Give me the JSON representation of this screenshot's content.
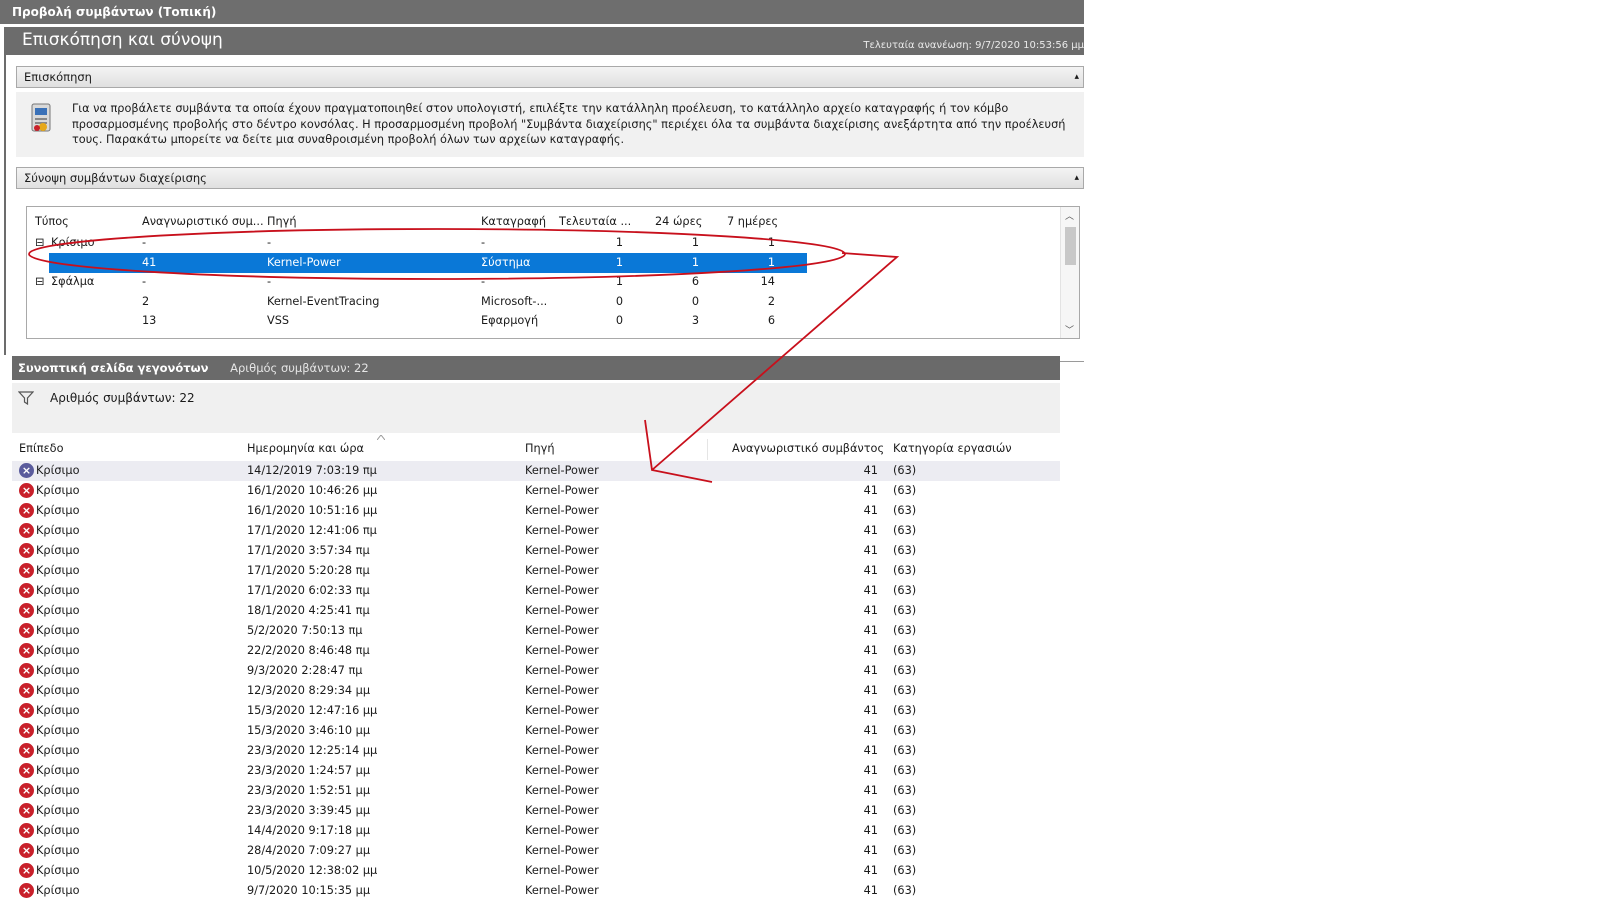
{
  "window": {
    "title": "Προβολή συμβάντων (Τοπική)"
  },
  "header": {
    "title": "Επισκόπηση και σύνοψη",
    "last_refresh": "Τελευταία ανανέωση: 9/7/2020 10:53:56 μμ"
  },
  "overview": {
    "label": "Επισκόπηση",
    "text": "Για να προβάλετε συμβάντα τα οποία έχουν πραγματοποιηθεί στον υπολογιστή, επιλέξτε την κατάλληλη προέλευση, το κατάλληλο αρχείο καταγραφής ή τον κόμβο προσαρμοσμένης προβολής στο δέντρο κονσόλας. Η προσαρμοσμένη προβολή \"Συμβάντα διαχείρισης\" περιέχει όλα τα συμβάντα διαχείρισης ανεξάρτητα από την προέλευσή τους. Παρακάτω μπορείτε να δείτε μια συναθροισμένη προβολή όλων των αρχείων καταγραφής."
  },
  "summary": {
    "label": "Σύνοψη συμβάντων διαχείρισης",
    "columns": [
      "Τύπος",
      "Αναγνωριστικό συμ...",
      "Πηγή",
      "Καταγραφή",
      "Τελευταία ...",
      "24 ώρες",
      "7 ημέρες"
    ],
    "rows": [
      {
        "type": "Κρίσιμο",
        "expand": "⊟",
        "id": "-",
        "source": "-",
        "log": "-",
        "last": "1",
        "h24": "1",
        "d7": "1"
      },
      {
        "type": "",
        "expand": "",
        "id": "41",
        "source": "Kernel-Power",
        "log": "Σύστημα",
        "last": "1",
        "h24": "1",
        "d7": "1"
      },
      {
        "type": "Σφάλμα",
        "expand": "⊟",
        "id": "-",
        "source": "-",
        "log": "-",
        "last": "1",
        "h24": "6",
        "d7": "14"
      },
      {
        "type": "",
        "expand": "",
        "id": "2",
        "source": "Kernel-EventTracing",
        "log": "Microsoft-...",
        "last": "0",
        "h24": "0",
        "d7": "2"
      },
      {
        "type": "",
        "expand": "",
        "id": "13",
        "source": "VSS",
        "log": "Εφαρμογή",
        "last": "0",
        "h24": "3",
        "d7": "6"
      }
    ]
  },
  "events_page": {
    "title": "Συνοπτική σελίδα γεγονότων",
    "count_label": "Αριθμός συμβάντων: 22",
    "filter_count": "Αριθμός συμβάντων: 22",
    "columns": [
      "Επίπεδο",
      "Ημερομηνία και ώρα",
      "Πηγή",
      "Αναγνωριστικό συμβάντος",
      "Κατηγορία εργασιών"
    ],
    "rows": [
      {
        "level": "Κρίσιμο",
        "datetime": "14/12/2019 7:03:19 πμ",
        "source": "Kernel-Power",
        "id": "41",
        "category": "(63)"
      },
      {
        "level": "Κρίσιμο",
        "datetime": "16/1/2020 10:46:26 μμ",
        "source": "Kernel-Power",
        "id": "41",
        "category": "(63)"
      },
      {
        "level": "Κρίσιμο",
        "datetime": "16/1/2020 10:51:16 μμ",
        "source": "Kernel-Power",
        "id": "41",
        "category": "(63)"
      },
      {
        "level": "Κρίσιμο",
        "datetime": "17/1/2020 12:41:06 πμ",
        "source": "Kernel-Power",
        "id": "41",
        "category": "(63)"
      },
      {
        "level": "Κρίσιμο",
        "datetime": "17/1/2020 3:57:34 πμ",
        "source": "Kernel-Power",
        "id": "41",
        "category": "(63)"
      },
      {
        "level": "Κρίσιμο",
        "datetime": "17/1/2020 5:20:28 πμ",
        "source": "Kernel-Power",
        "id": "41",
        "category": "(63)"
      },
      {
        "level": "Κρίσιμο",
        "datetime": "17/1/2020 6:02:33 πμ",
        "source": "Kernel-Power",
        "id": "41",
        "category": "(63)"
      },
      {
        "level": "Κρίσιμο",
        "datetime": "18/1/2020 4:25:41 πμ",
        "source": "Kernel-Power",
        "id": "41",
        "category": "(63)"
      },
      {
        "level": "Κρίσιμο",
        "datetime": "5/2/2020 7:50:13 πμ",
        "source": "Kernel-Power",
        "id": "41",
        "category": "(63)"
      },
      {
        "level": "Κρίσιμο",
        "datetime": "22/2/2020 8:46:48 πμ",
        "source": "Kernel-Power",
        "id": "41",
        "category": "(63)"
      },
      {
        "level": "Κρίσιμο",
        "datetime": "9/3/2020 2:28:47 πμ",
        "source": "Kernel-Power",
        "id": "41",
        "category": "(63)"
      },
      {
        "level": "Κρίσιμο",
        "datetime": "12/3/2020 8:29:34 μμ",
        "source": "Kernel-Power",
        "id": "41",
        "category": "(63)"
      },
      {
        "level": "Κρίσιμο",
        "datetime": "15/3/2020 12:47:16 μμ",
        "source": "Kernel-Power",
        "id": "41",
        "category": "(63)"
      },
      {
        "level": "Κρίσιμο",
        "datetime": "15/3/2020 3:46:10 μμ",
        "source": "Kernel-Power",
        "id": "41",
        "category": "(63)"
      },
      {
        "level": "Κρίσιμο",
        "datetime": "23/3/2020 12:25:14 μμ",
        "source": "Kernel-Power",
        "id": "41",
        "category": "(63)"
      },
      {
        "level": "Κρίσιμο",
        "datetime": "23/3/2020 1:24:57 μμ",
        "source": "Kernel-Power",
        "id": "41",
        "category": "(63)"
      },
      {
        "level": "Κρίσιμο",
        "datetime": "23/3/2020 1:52:51 μμ",
        "source": "Kernel-Power",
        "id": "41",
        "category": "(63)"
      },
      {
        "level": "Κρίσιμο",
        "datetime": "23/3/2020 3:39:45 μμ",
        "source": "Kernel-Power",
        "id": "41",
        "category": "(63)"
      },
      {
        "level": "Κρίσιμο",
        "datetime": "14/4/2020 9:17:18 μμ",
        "source": "Kernel-Power",
        "id": "41",
        "category": "(63)"
      },
      {
        "level": "Κρίσιμο",
        "datetime": "28/4/2020 7:09:27 μμ",
        "source": "Kernel-Power",
        "id": "41",
        "category": "(63)"
      },
      {
        "level": "Κρίσιμο",
        "datetime": "10/5/2020 12:38:02 μμ",
        "source": "Kernel-Power",
        "id": "41",
        "category": "(63)"
      },
      {
        "level": "Κρίσιμο",
        "datetime": "9/7/2020 10:15:35 μμ",
        "source": "Kernel-Power",
        "id": "41",
        "category": "(63)"
      }
    ]
  },
  "icons": {
    "collapse": "▴",
    "expand_box": "⊟",
    "scroll_up": "︿",
    "scroll_down": "﹀",
    "filter": "filter-icon",
    "error": "error-icon",
    "sort": "sort-arrow-icon"
  },
  "colors": {
    "selection": "#0a78d7",
    "annotation": "#c8101c",
    "error": "#c8202a",
    "band": "#6c6c6c"
  }
}
